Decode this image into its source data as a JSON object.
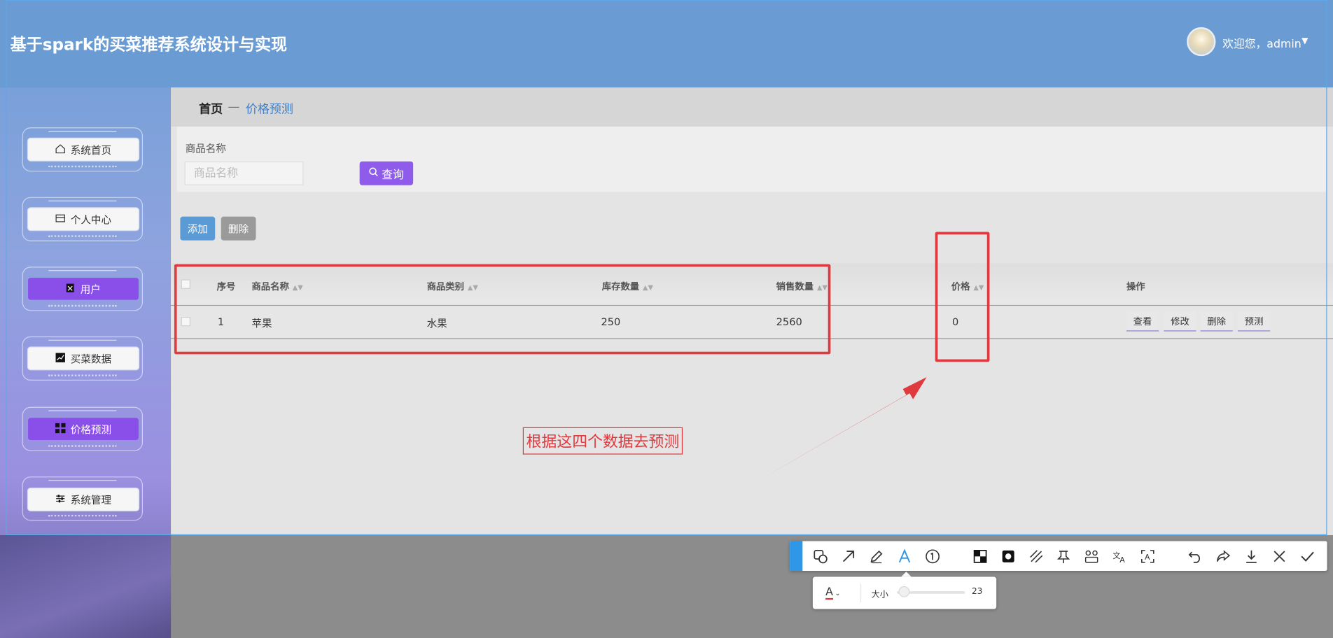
{
  "app": {
    "title": "基于spark的买菜推荐系统设计与实现"
  },
  "header": {
    "welcome_text": "欢迎您，admin",
    "avatar_icon": "user-avatar"
  },
  "breadcrumb": {
    "home": "首页",
    "separator": "—",
    "current": "价格预测"
  },
  "sidebar": {
    "items": [
      {
        "label": "系统首页",
        "icon": "home-icon",
        "active": false
      },
      {
        "label": "个人中心",
        "icon": "id-card-icon",
        "active": false
      },
      {
        "label": "用户",
        "icon": "user-clipboard-icon",
        "active": true
      },
      {
        "label": "买菜数据",
        "icon": "line-chart-icon",
        "active": false
      },
      {
        "label": "价格预测",
        "icon": "grid-icon",
        "active": true
      },
      {
        "label": "系统管理",
        "icon": "sliders-icon",
        "active": false
      }
    ]
  },
  "search": {
    "label": "商品名称",
    "placeholder": "商品名称",
    "value": "",
    "button_label": "查询"
  },
  "actions": {
    "add_label": "添加",
    "delete_label": "删除"
  },
  "table": {
    "columns": [
      "序号",
      "商品名称",
      "商品类别",
      "库存数量",
      "销售数量",
      "价格",
      "操作"
    ],
    "rows": [
      {
        "index": "1",
        "name": "苹果",
        "category": "水果",
        "stock": "250",
        "sales": "2560",
        "price": "0",
        "ops": [
          "查看",
          "修改",
          "删除",
          "预测"
        ]
      }
    ]
  },
  "annotation": {
    "text": "根据这四个数据去预测"
  },
  "toolbar": {
    "size_label": "大小",
    "size_value": "23",
    "size_level": 0.1,
    "text_color": "#e0393e"
  },
  "colors": {
    "header": "#6a9bd3",
    "accent_purple": "#8a4fe8",
    "annotation_red": "#e0393e",
    "link_blue": "#3f7fc9"
  }
}
